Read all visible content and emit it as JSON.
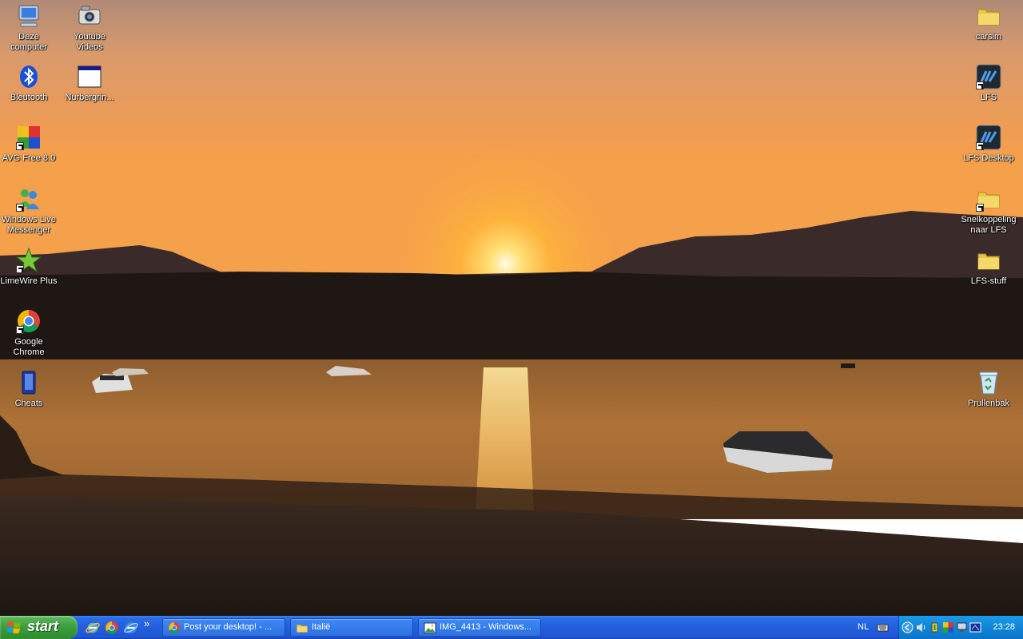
{
  "desktop": {
    "left_icons": [
      {
        "label": "Deze\ncomputer",
        "icon": "my-computer-icon"
      },
      {
        "label": "Youtube\nVideos",
        "icon": "camera-folder-icon"
      },
      {
        "label": "Bleutooth",
        "icon": "bluetooth-icon"
      },
      {
        "label": "Nurbergrin...",
        "icon": "window-icon"
      },
      {
        "label": "AVG Free 8.0",
        "icon": "avg-icon"
      },
      {
        "label": "Windows Live\nMessenger",
        "icon": "messenger-icon"
      },
      {
        "label": "LimeWire Plus",
        "icon": "limewire-icon"
      },
      {
        "label": "Google\nChrome",
        "icon": "chrome-icon"
      },
      {
        "label": "Cheats",
        "icon": "cheats-icon"
      }
    ],
    "right_icons": [
      {
        "label": "carsim",
        "icon": "folder-icon"
      },
      {
        "label": "LFS",
        "icon": "lfs-icon"
      },
      {
        "label": "LFS Desktop",
        "icon": "lfs-icon"
      },
      {
        "label": "Snelkoppeling\nnaar LFS",
        "icon": "folder-shortcut-icon"
      },
      {
        "label": "LFS-stuff",
        "icon": "folder-icon"
      },
      {
        "label": "Prullenbak",
        "icon": "recycle-bin-icon"
      }
    ]
  },
  "taskbar": {
    "start_label": "start",
    "quick_launch": [
      "ie-icon",
      "chrome-icon",
      "ie-blue-icon"
    ],
    "quick_launch_more": "»",
    "buttons": [
      {
        "label": "Post your desktop! - ...",
        "icon": "chrome-icon"
      },
      {
        "label": "Italië",
        "icon": "folder-icon"
      },
      {
        "label": "IMG_4413 - Windows...",
        "icon": "image-viewer-icon"
      }
    ],
    "language": "NL",
    "clock": "23:28"
  },
  "colors": {
    "taskbar_blue": "#245edc",
    "start_green": "#3c9d3c",
    "tray_blue": "#0f85d8",
    "sunset_orange": "#f29a3c"
  }
}
